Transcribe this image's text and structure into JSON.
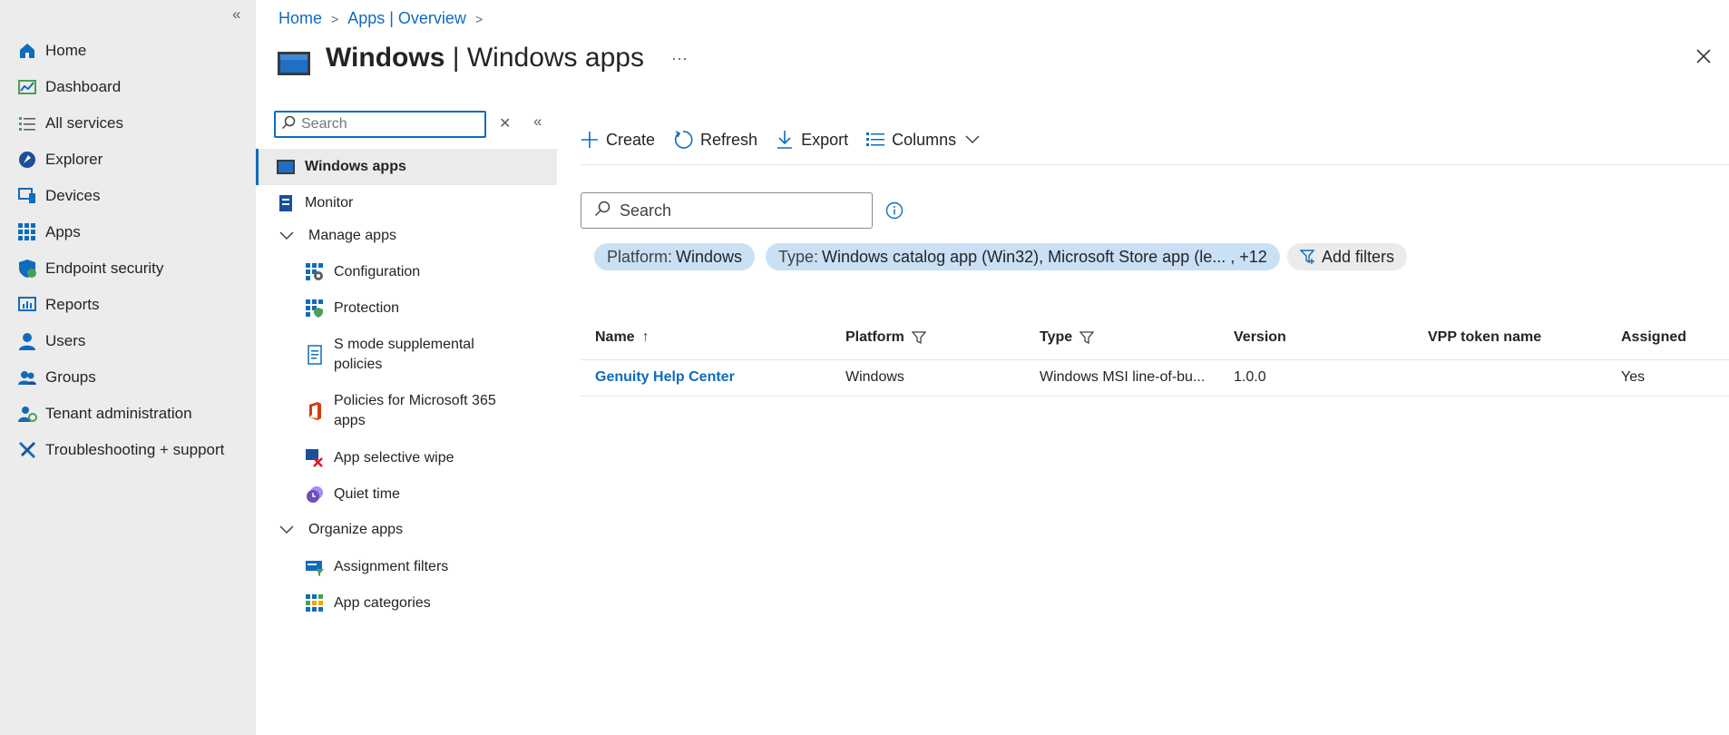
{
  "leftnav": {
    "collapse_glyph": "«",
    "items": [
      {
        "label": "Home",
        "icon": "home-icon"
      },
      {
        "label": "Dashboard",
        "icon": "dashboard-icon"
      },
      {
        "label": "All services",
        "icon": "list-icon"
      },
      {
        "label": "Explorer",
        "icon": "explorer-icon"
      },
      {
        "label": "Devices",
        "icon": "devices-icon"
      },
      {
        "label": "Apps",
        "icon": "apps-grid-icon"
      },
      {
        "label": "Endpoint security",
        "icon": "shield-icon"
      },
      {
        "label": "Reports",
        "icon": "reports-icon"
      },
      {
        "label": "Users",
        "icon": "user-icon"
      },
      {
        "label": "Groups",
        "icon": "groups-icon"
      },
      {
        "label": "Tenant administration",
        "icon": "tenant-admin-icon"
      },
      {
        "label": "Troubleshooting + support",
        "icon": "wrench-icon"
      }
    ]
  },
  "breadcrumb": [
    {
      "label": "Home"
    },
    {
      "label": "Apps | Overview"
    }
  ],
  "header": {
    "title_bold": "Windows",
    "title_rest": " | Windows apps",
    "more_glyph": "···"
  },
  "resource_menu": {
    "search_placeholder": "Search",
    "items": {
      "windows_apps": "Windows apps",
      "monitor": "Monitor",
      "manage_apps": "Manage apps",
      "configuration": "Configuration",
      "protection": "Protection",
      "s_mode_line1": "S mode supplemental",
      "s_mode_line2": "policies",
      "m365_line1": "Policies for Microsoft 365",
      "m365_line2": "apps",
      "selective_wipe": "App selective wipe",
      "quiet_time": "Quiet time",
      "organize_apps": "Organize apps",
      "assignment_filters": "Assignment filters",
      "app_categories": "App categories"
    }
  },
  "toolbar": {
    "create": "Create",
    "refresh": "Refresh",
    "export": "Export",
    "columns": "Columns"
  },
  "main_search": {
    "placeholder": "Search"
  },
  "filters": [
    {
      "key": "Platform:",
      "value": "Windows"
    },
    {
      "key": "Type:",
      "value": "Windows catalog app (Win32), Microsoft Store app (le... , +12"
    }
  ],
  "add_filters": "Add filters",
  "table": {
    "columns": [
      "Name",
      "Platform",
      "Type",
      "Version",
      "VPP token name",
      "Assigned"
    ],
    "sort_glyph": "↑",
    "rows": [
      {
        "name": "Genuity Help Center",
        "platform": "Windows",
        "type": "Windows MSI line-of-bu...",
        "version": "1.0.0",
        "vpp": "",
        "assigned": "Yes"
      }
    ]
  },
  "colors": {
    "accent": "#0f6cbd",
    "pill": "#c9e0f5",
    "nav_bg": "#ececec"
  }
}
